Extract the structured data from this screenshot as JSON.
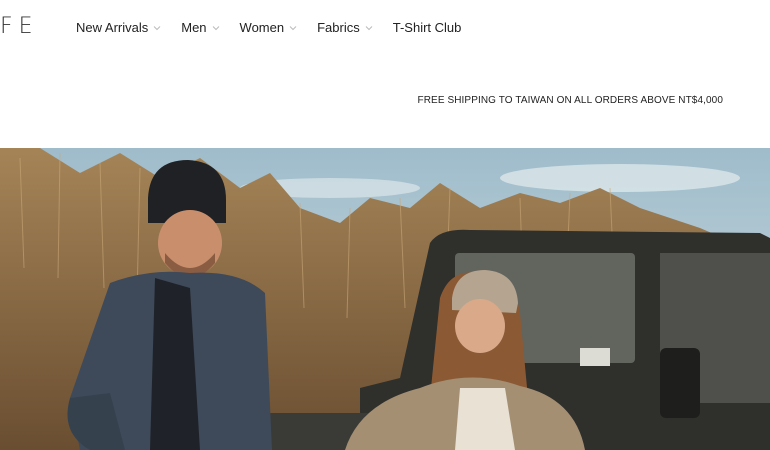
{
  "header": {
    "logo_text": "FE",
    "nav": [
      {
        "label": "New Arrivals",
        "has_dropdown": true
      },
      {
        "label": "Men",
        "has_dropdown": true
      },
      {
        "label": "Women",
        "has_dropdown": true
      },
      {
        "label": "Fabrics",
        "has_dropdown": true
      },
      {
        "label": "T-Shirt Club",
        "has_dropdown": false
      }
    ]
  },
  "promo_banner": {
    "text": "FREE SHIPPING TO TAIWAN ON ALL ORDERS ABOVE NT$4,000"
  },
  "hero": {
    "image_icon": "hero-photo",
    "colors": {
      "sky": "#a9c3cf",
      "grass": "#8a6a45",
      "jacket": "#3e4a59",
      "vehicle": "#2f2f2c"
    }
  }
}
